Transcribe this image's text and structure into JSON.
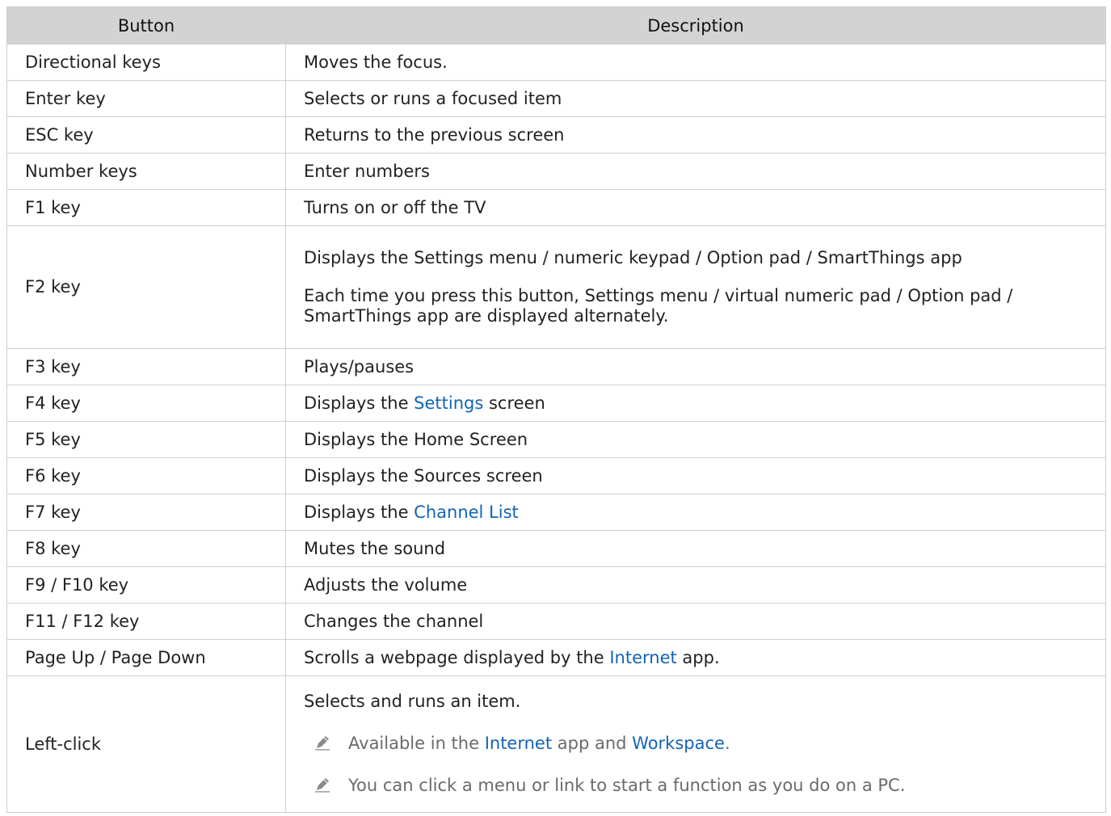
{
  "table": {
    "headers": {
      "button": "Button",
      "description": "Description"
    },
    "rows": {
      "directional": {
        "button": "Directional keys",
        "desc": "Moves the focus."
      },
      "enter": {
        "button": "Enter key",
        "desc": "Selects or runs a focused item"
      },
      "esc": {
        "button": "ESC key",
        "desc": "Returns to the previous screen"
      },
      "number": {
        "button": "Number keys",
        "desc": "Enter numbers"
      },
      "f1": {
        "button": "F1 key",
        "desc": "Turns on or off the TV"
      },
      "f2": {
        "button": "F2 key",
        "desc_line1": "Displays the Settings menu / numeric keypad / Option pad / SmartThings app",
        "desc_line2": "Each time you press this button, Settings menu / virtual numeric pad / Option pad / SmartThings app are displayed alternately."
      },
      "f3": {
        "button": "F3 key",
        "desc": "Plays/pauses"
      },
      "f4": {
        "button": "F4 key",
        "desc_before": "Displays the ",
        "desc_link": "Settings",
        "desc_after": " screen"
      },
      "f5": {
        "button": "F5 key",
        "desc": "Displays the Home Screen"
      },
      "f6": {
        "button": "F6 key",
        "desc": "Displays the Sources screen"
      },
      "f7": {
        "button": "F7 key",
        "desc_before": "Displays the ",
        "desc_link": "Channel List"
      },
      "f8": {
        "button": "F8 key",
        "desc": "Mutes the sound"
      },
      "f9_f10": {
        "button": "F9 / F10 key",
        "desc": "Adjusts the volume"
      },
      "f11_f12": {
        "button": "F11 / F12 key",
        "desc": "Changes the channel"
      },
      "page": {
        "button": "Page Up / Page Down",
        "desc_before": "Scrolls a webpage displayed by the ",
        "desc_link": "Internet",
        "desc_after": " app."
      },
      "left_click": {
        "button": "Left-click",
        "desc": "Selects and runs an item.",
        "note1": {
          "before": "Available in the ",
          "link1": "Internet",
          "middle": " app and ",
          "link2": "Workspace",
          "after": "."
        },
        "note2": "You can click a menu or link to start a function as you do on a PC."
      }
    }
  },
  "icons": {
    "note": "pencil-note-icon"
  },
  "colors": {
    "header_bg": "#d3d3d3",
    "link": "#1264b7",
    "note_text": "#6a6a6a",
    "border": "#cfcfcf"
  }
}
